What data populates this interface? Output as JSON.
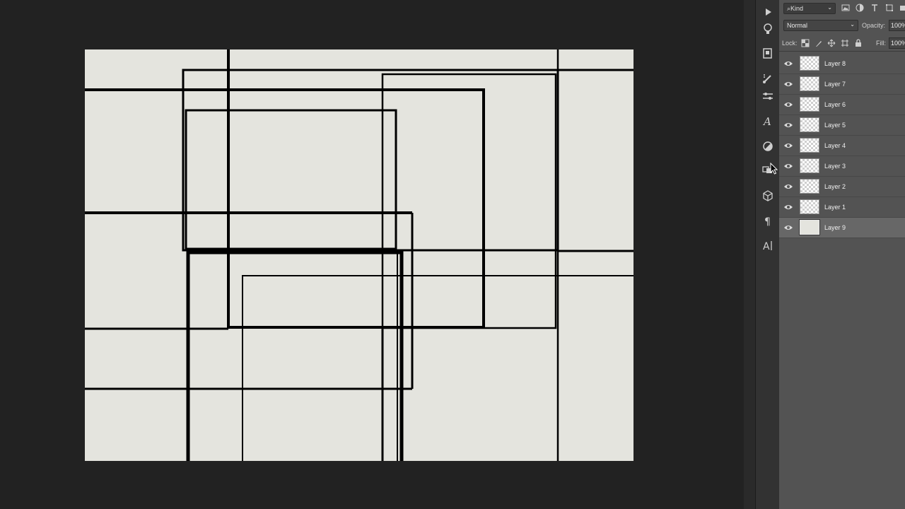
{
  "panel": {
    "filter_kind": "Kind",
    "blend_mode": "Normal",
    "opacity_label": "Opacity:",
    "opacity_value": "100%",
    "lock_label": "Lock:",
    "fill_label": "Fill:",
    "fill_value": "100%"
  },
  "layers": [
    {
      "name": "Layer 8",
      "visible": true,
      "selected": false
    },
    {
      "name": "Layer 7",
      "visible": true,
      "selected": false
    },
    {
      "name": "Layer 6",
      "visible": true,
      "selected": false
    },
    {
      "name": "Layer 5",
      "visible": true,
      "selected": false
    },
    {
      "name": "Layer 4",
      "visible": true,
      "selected": false
    },
    {
      "name": "Layer 3",
      "visible": true,
      "selected": false
    },
    {
      "name": "Layer 2",
      "visible": true,
      "selected": false
    },
    {
      "name": "Layer 1",
      "visible": true,
      "selected": false
    },
    {
      "name": "Layer 9",
      "visible": true,
      "selected": true
    }
  ],
  "tools": [
    "play-icon",
    "lightbulb-icon",
    "libraries-icon",
    "brush-settings-icon",
    "adjustments-sliders-icon",
    "character-styles-icon",
    "color-adjust-icon",
    "actions-icon",
    "3d-cube-icon",
    "paragraph-icon",
    "character-icon"
  ],
  "colors": {
    "canvas": "#e4e4de",
    "workspace": "#222222",
    "panel": "#535353",
    "selected_layer": "#676767"
  }
}
